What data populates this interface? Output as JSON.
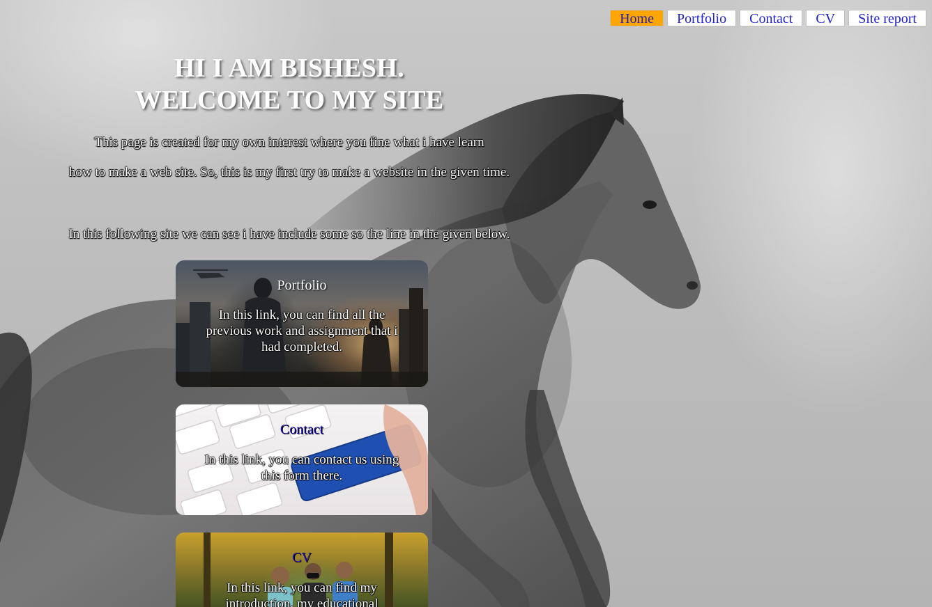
{
  "nav": {
    "items": [
      {
        "label": "Home",
        "active": true
      },
      {
        "label": "Portfolio",
        "active": false
      },
      {
        "label": "Contact",
        "active": false
      },
      {
        "label": "CV",
        "active": false
      },
      {
        "label": "Site report",
        "active": false
      }
    ]
  },
  "hero": {
    "line1": "HI I AM BISHESH.",
    "line2": "WELCOME TO MY SITE"
  },
  "intro": {
    "p1": "This page is created for my own interest where you fine what i have learn",
    "p2": "how to make a web site. So, this is my first try to make a website in the given time.",
    "p3": "In this following site we can see i have include some so the line in the given below."
  },
  "cards": {
    "portfolio": {
      "title": "Portfolio",
      "text": "In this link, you can find all the previous work and assignment that i had completed."
    },
    "contact": {
      "title": "Contact",
      "text": "In this link, you can contact us using this form there."
    },
    "cv": {
      "title": "CV",
      "text": "In this link, you can find my introduction, my educational"
    }
  },
  "colors": {
    "nav_active": "#ffa500",
    "nav_text": "#2222cc",
    "card_heading": "#1a10a8"
  },
  "icons": {
    "background": "horse-painting",
    "contact_key": "contact-us-key"
  }
}
